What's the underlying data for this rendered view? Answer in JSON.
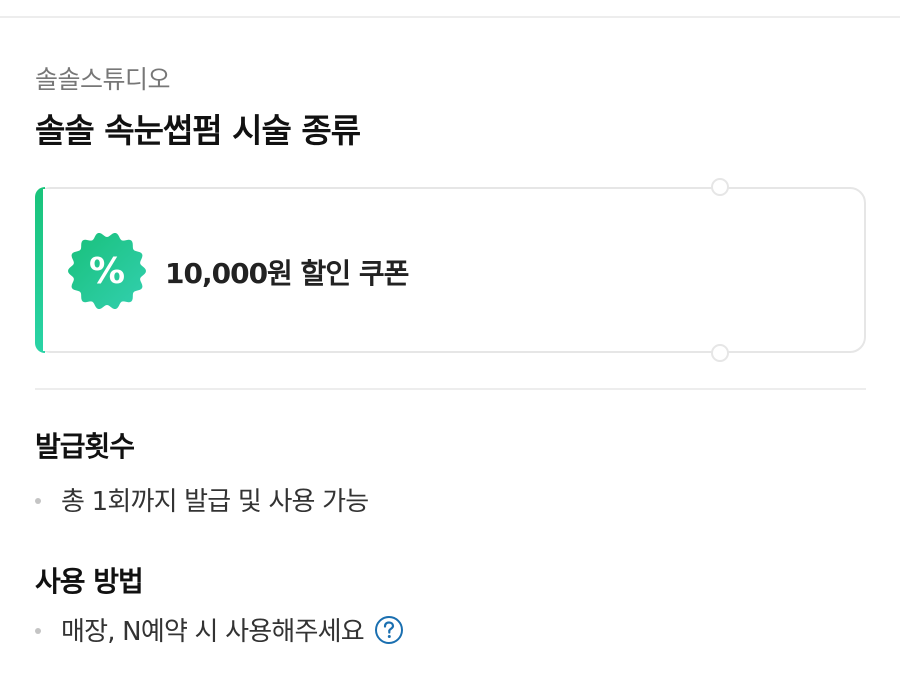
{
  "header": {
    "store_name": "솔솔스튜디오",
    "product_title": "솔솔 속눈썹펌 시술 종류"
  },
  "coupon": {
    "label": "10,000원 할인 쿠폰",
    "badge_symbol": "%",
    "badge_icon": "percent-badge-icon",
    "accent_color": "#19c37a",
    "accent_color_end": "#2ad3a6"
  },
  "issuance": {
    "heading": "발급횟수",
    "detail": "총 1회까지 발급 및 사용 가능"
  },
  "usage": {
    "heading": "사용 방법",
    "detail": "매장, N예약 시 사용해주세요",
    "help_icon": "question-circle-icon",
    "help_color": "#1a6fb0"
  }
}
